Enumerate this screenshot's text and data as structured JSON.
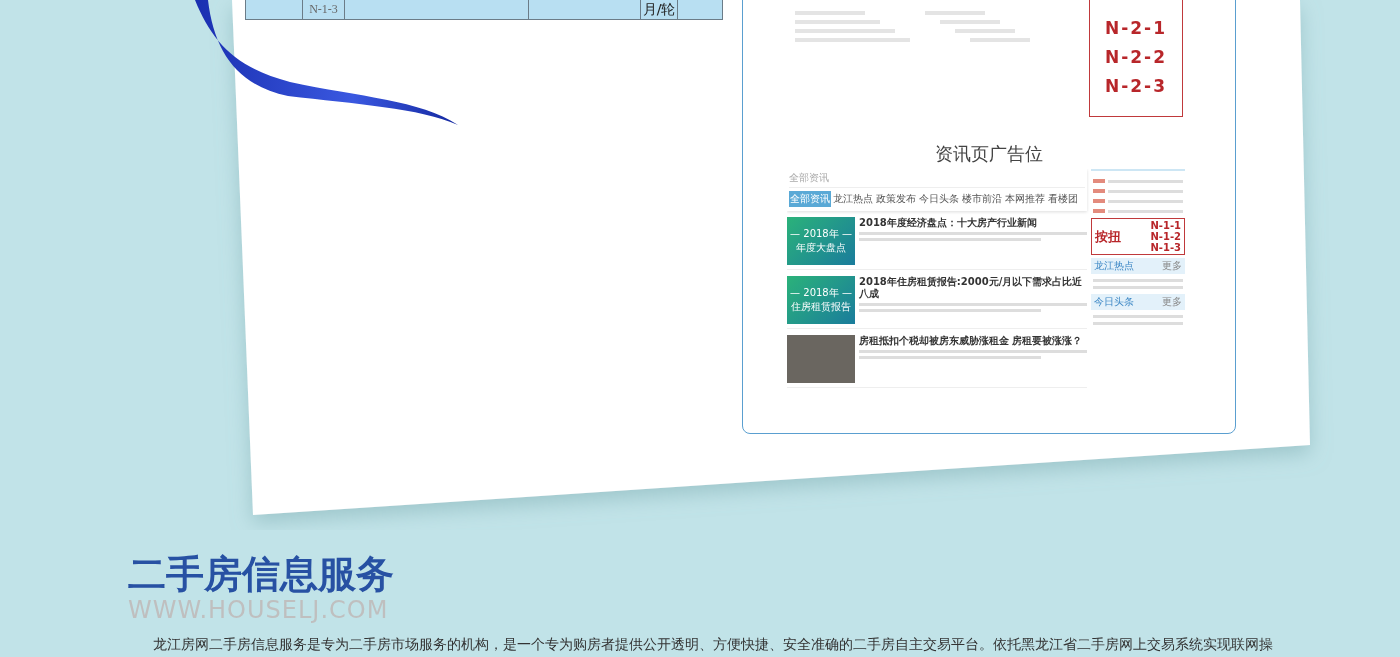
{
  "spec_table": {
    "cells": [
      "",
      "N-1-3",
      "",
      "",
      "月/轮",
      ""
    ]
  },
  "detail_panel": {
    "ad_codes": [
      "N-2-1",
      "N-2-2",
      "N-2-3"
    ],
    "news_ad": {
      "title": "资讯页广告位",
      "screenshot": {
        "heading": "全部资讯",
        "tabs": [
          {
            "label": "全部资讯",
            "selected": true
          },
          {
            "label": "龙江热点",
            "selected": false
          },
          {
            "label": "政策发布",
            "selected": false
          },
          {
            "label": "今日头条",
            "selected": false
          },
          {
            "label": "楼市前沿",
            "selected": false
          },
          {
            "label": "本网推荐",
            "selected": false
          },
          {
            "label": "看楼团",
            "selected": false
          }
        ],
        "articles": [
          {
            "kind": "banner",
            "title": "2018年度经济盘点：十大房产行业新闻",
            "thumb": [
              "— 2018年 —",
              "年度大盘点"
            ]
          },
          {
            "kind": "banner",
            "title": "2018年住房租赁报告:2000元/月以下需求占比近八成",
            "thumb": [
              "— 2018年 —",
              "住房租赁报告"
            ]
          },
          {
            "kind": "photo",
            "title": "房租抵扣个税却被房东威胁涨租金 房租要被涨涨？"
          }
        ],
        "sidebar": {
          "ad_label": "按扭",
          "ad_codes": [
            "N-1-1",
            "N-1-2",
            "N-1-3"
          ],
          "sections": [
            {
              "title": "龙江热点",
              "more": "更多"
            },
            {
              "title": "今日头条",
              "more": "更多"
            }
          ]
        }
      }
    }
  },
  "service": {
    "title": "二手房信息服务",
    "url": "WWW.HOUSELJ.COM",
    "description": "龙江房网二手房信息服务是专为二手房市场服务的机构，是一个专为购房者提供公开透明、方便快捷、安全准确的二手房自主交易平台。依托黑龙江省二手房网上交易系统实现联网操"
  }
}
